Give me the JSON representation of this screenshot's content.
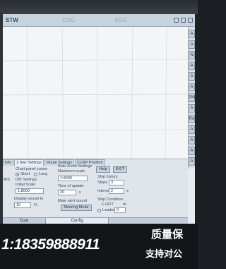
{
  "statusbar": {
    "stw_label": "STW",
    "cog_label": "COG",
    "sog_label": "SOG"
  },
  "right_toolbar": {
    "buttons": [
      "A",
      "A",
      "N",
      "A",
      "A",
      "A",
      "TM",
      "A",
      "Ro",
      "A",
      "A",
      "A",
      "A"
    ]
  },
  "panel": {
    "tabs": [
      "Info",
      "2 Nav Settings",
      "Route Settings",
      "CCRP Position"
    ],
    "chart_panel_cursor_label": "Chart panel cursor",
    "chart_panel_cursor_options": [
      "Short",
      "Long"
    ],
    "chart_panel_cursor_selected": "Short",
    "ais_label": "AIS",
    "dm_settings_label": "DM Settings",
    "initial_scale_label": "Initial Scale",
    "initial_scale_value": "1:8000",
    "display_vessel_label": "Display vessel to",
    "display_vessel_value": "10",
    "display_vessel_unit": "%",
    "autozoom_label": "Auto Zoom Settings",
    "max_scale_label": "Maximum scale",
    "max_scale_value": "1:8000",
    "time_update_label": "Time of update",
    "time_update_value": "20",
    "time_update_unit": "s",
    "mate_alert_label": "Mate alert sound",
    "mooring_mode_label": "Mooring Mode",
    "help_label": "Help",
    "exit_label": "EXIT",
    "ship_history_label": "Ship history",
    "steps_label": "Steps",
    "steps_value": "3",
    "interval_label": "Interval",
    "interval_value": "2",
    "interval_unit": "s",
    "ship_condition_label": "Ship Condition",
    "draft_label": "F-DOT",
    "draft_unit": "m",
    "loaded_label": "Loaded",
    "loaded_value": "0"
  },
  "bottom_tabs": {
    "dual_label": "Dual",
    "config_label": "Config"
  },
  "banner": {
    "phone": "1:18359888911",
    "ad_line1": "质量保",
    "ad_line2": "支持对公"
  },
  "colors": {
    "chart_bg": "#f3f5f7",
    "grid_line": "#d4dae0",
    "panel_bg": "#dfe5eb",
    "status_text": "#2d4a6a"
  }
}
